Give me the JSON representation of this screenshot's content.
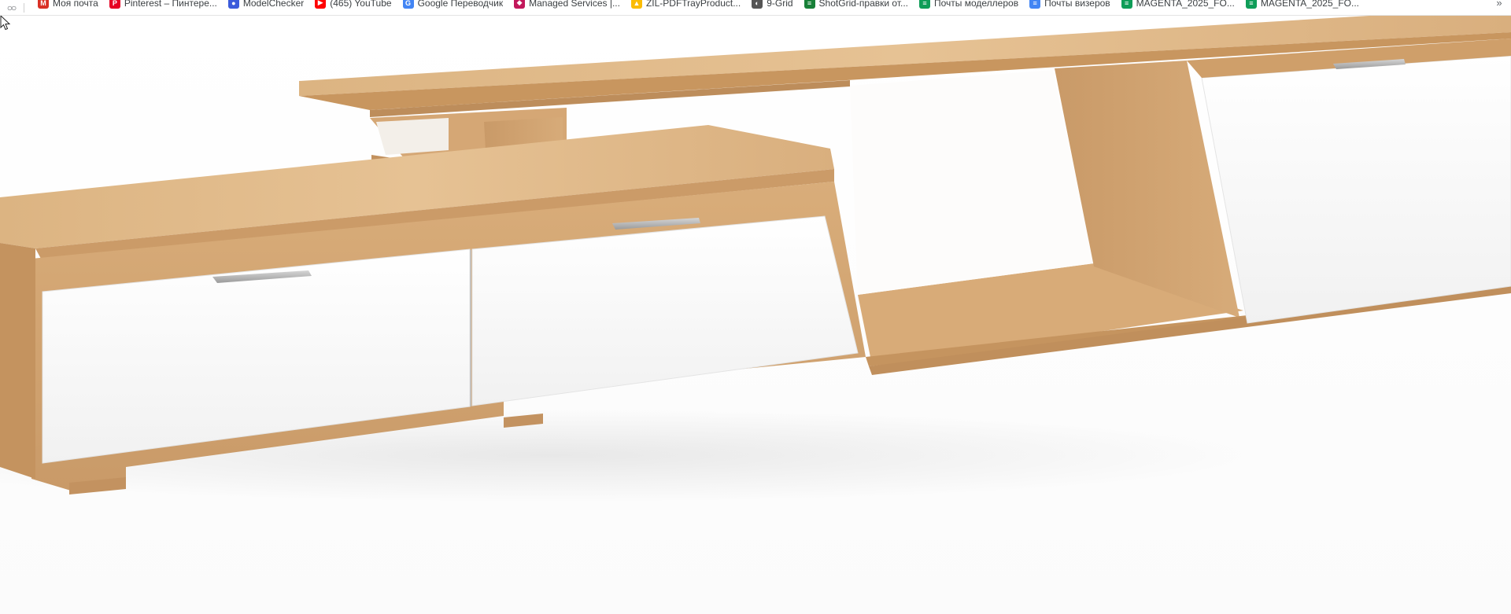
{
  "bookmarks_bar": {
    "items": [
      {
        "label": "Моя почта",
        "icon": "gmail-icon",
        "color": "#d93025",
        "glyph": "M"
      },
      {
        "label": "Pinterest – Пинтере...",
        "icon": "pinterest-icon",
        "color": "#e60023",
        "glyph": "P"
      },
      {
        "label": "ModelChecker",
        "icon": "modelchecker-icon",
        "color": "#3b5bdb",
        "glyph": "●"
      },
      {
        "label": "(465) YouTube",
        "icon": "youtube-icon",
        "color": "#ff0000",
        "glyph": "▶"
      },
      {
        "label": "Google Переводчик",
        "icon": "google-translate-icon",
        "color": "#4285f4",
        "glyph": "G"
      },
      {
        "label": "Managed Services |...",
        "icon": "managed-services-icon",
        "color": "#c2185b",
        "glyph": "◆"
      },
      {
        "label": "ZIL-PDFTrayProduct...",
        "icon": "google-drive-icon",
        "color": "#fbbc04",
        "glyph": "▲"
      },
      {
        "label": "9-Grid",
        "icon": "grid-icon",
        "color": "#555555",
        "glyph": "◐"
      },
      {
        "label": "ShotGrid-правки от...",
        "icon": "sheets-icon",
        "color": "#188038",
        "glyph": "≡"
      },
      {
        "label": "Почты моделлеров",
        "icon": "sheets-icon",
        "color": "#0f9d58",
        "glyph": "≡"
      },
      {
        "label": "Почты визеров",
        "icon": "docs-icon",
        "color": "#4285f4",
        "glyph": "≡"
      },
      {
        "label": "MAGENTA_2025_FO...",
        "icon": "sheets-icon",
        "color": "#0f9d58",
        "glyph": "≡"
      },
      {
        "label": "MAGENTA_2025_FO...",
        "icon": "sheets-icon",
        "color": "#0f9d58",
        "glyph": "≡"
      }
    ],
    "more": "»"
  },
  "colors": {
    "wood_light": "#e2bc8c",
    "wood_mid": "#d4a877",
    "wood_dark": "#c08f5f",
    "drawer_front": "#f6f6f6",
    "handle": "#b9b9b9"
  }
}
